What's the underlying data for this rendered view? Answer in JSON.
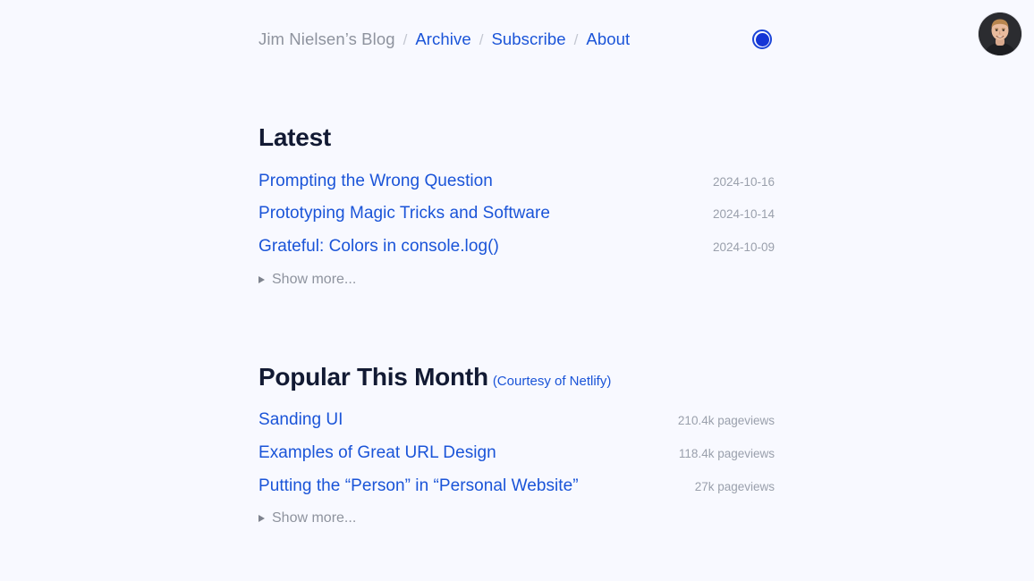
{
  "site": {
    "avatar_alt": "Jim Nielsen portrait photo"
  },
  "nav": {
    "current_site": "Jim Nielsen’s Blog",
    "separator": "/",
    "links": [
      {
        "label": "Archive"
      },
      {
        "label": "Subscribe"
      },
      {
        "label": "About"
      }
    ],
    "theme_toggle_name": "theme-toggle-circle"
  },
  "theme": {
    "background": "#f8f9ff",
    "link_blue": "#1a54d8",
    "heading_navy": "#121a33",
    "muted_gray": "#9aa0ac",
    "separator_gray": "#c3c7d1",
    "toggle_blue": "#1435d6"
  },
  "latest": {
    "title": "Latest",
    "posts": [
      {
        "title": "Prompting the Wrong Question",
        "date": "2024-10-16"
      },
      {
        "title": "Prototyping Magic Tricks and Software",
        "date": "2024-10-14"
      },
      {
        "title": "Grateful: Colors in console.log()",
        "date": "2024-10-09"
      }
    ],
    "show_more": "Show more..."
  },
  "popular": {
    "title": "Popular This Month",
    "subtitle": "(Courtesy of Netlify)",
    "posts": [
      {
        "title": "Sanding UI",
        "views": "210.4k pageviews"
      },
      {
        "title": "Examples of Great URL Design",
        "views": "118.4k pageviews"
      },
      {
        "title": "Putting the “Person” in “Personal Website”",
        "views": "27k pageviews"
      }
    ],
    "show_more": "Show more..."
  }
}
